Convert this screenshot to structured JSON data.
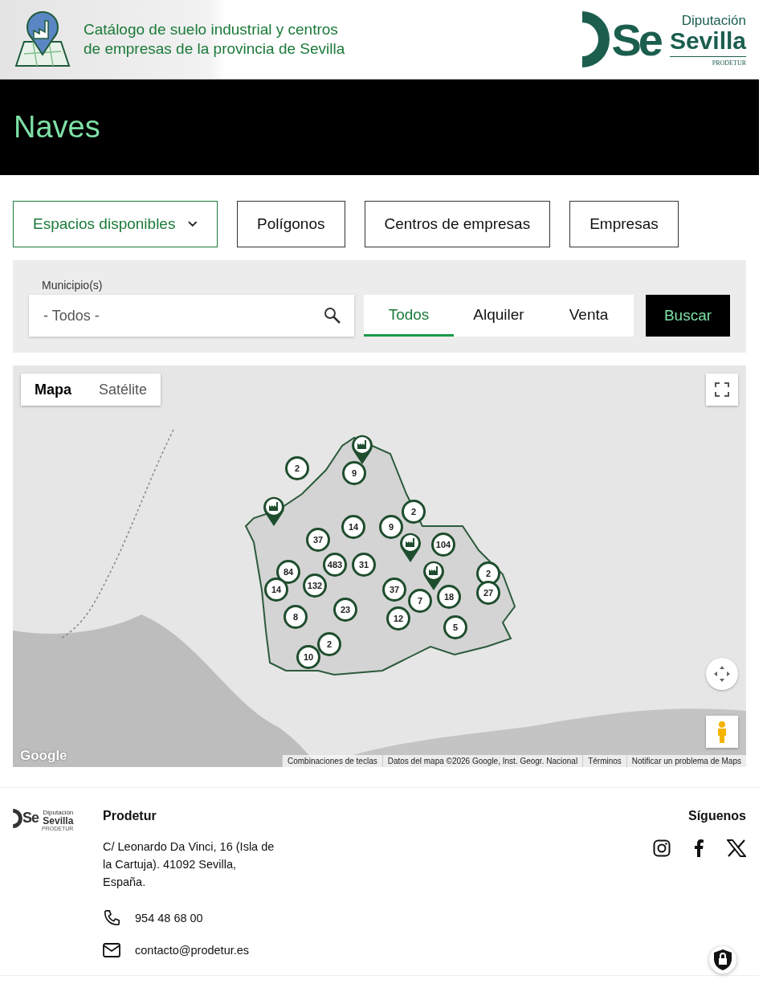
{
  "header": {
    "title": "Catálogo de suelo industrial y centros de empresas de la provincia de Sevilla",
    "logo": {
      "mark": "Se",
      "line_1": "Diputación",
      "line_2": "Sevilla",
      "line_3": "PRODETUR"
    }
  },
  "page_title": "Naves",
  "categories": [
    {
      "label": "Espacios disponibles",
      "selected": true,
      "dropdown": true
    },
    {
      "label": "Polígonos",
      "selected": false,
      "dropdown": false
    },
    {
      "label": "Centros de empresas",
      "selected": false,
      "dropdown": false
    },
    {
      "label": "Empresas",
      "selected": false,
      "dropdown": false
    }
  ],
  "search": {
    "label": "Municipio(s)",
    "value": "- Todos -",
    "modes": [
      {
        "label": "Todos",
        "selected": true
      },
      {
        "label": "Alquiler",
        "selected": false
      },
      {
        "label": "Venta",
        "selected": false
      }
    ],
    "button": "Buscar"
  },
  "map": {
    "types": [
      {
        "label": "Mapa",
        "selected": true
      },
      {
        "label": "Satélite",
        "selected": false
      }
    ],
    "markers": [
      {
        "kind": "cluster",
        "label": "2"
      },
      {
        "kind": "cluster",
        "label": "9"
      },
      {
        "kind": "cluster",
        "label": "14"
      },
      {
        "kind": "cluster",
        "label": "9"
      },
      {
        "kind": "cluster",
        "label": "2"
      },
      {
        "kind": "cluster",
        "label": "37"
      },
      {
        "kind": "cluster",
        "label": "104"
      },
      {
        "kind": "cluster",
        "label": "84"
      },
      {
        "kind": "cluster",
        "label": "483"
      },
      {
        "kind": "cluster",
        "label": "31"
      },
      {
        "kind": "cluster",
        "label": "14"
      },
      {
        "kind": "cluster",
        "label": "132"
      },
      {
        "kind": "cluster",
        "label": "37"
      },
      {
        "kind": "cluster",
        "label": "7"
      },
      {
        "kind": "cluster",
        "label": "18"
      },
      {
        "kind": "cluster",
        "label": "2"
      },
      {
        "kind": "cluster",
        "label": "27"
      },
      {
        "kind": "cluster",
        "label": "8"
      },
      {
        "kind": "cluster",
        "label": "23"
      },
      {
        "kind": "cluster",
        "label": "12"
      },
      {
        "kind": "cluster",
        "label": "5"
      },
      {
        "kind": "cluster",
        "label": "2"
      },
      {
        "kind": "cluster",
        "label": "10"
      },
      {
        "kind": "pin"
      },
      {
        "kind": "pin"
      },
      {
        "kind": "pin"
      },
      {
        "kind": "pin"
      }
    ],
    "google": "Google",
    "attribution": [
      "Combinaciones de teclas",
      "Datos del mapa ©2026 Google, Inst. Geogr. Nacional",
      "Términos",
      "Notificar un problema de Maps"
    ]
  },
  "footer": {
    "logo": {
      "mark": "Se",
      "line_1": "Diputación",
      "line_2": "Sevilla",
      "line_3": "PRODETUR"
    },
    "org": "Prodetur",
    "address": "C/ Leonardo Da Vinci, 16 (Isla de la Cartuja). 41092 Sevilla, España.",
    "phone": "954 48 68 00",
    "email": "contacto@prodetur.es",
    "follow": "Síguenos"
  }
}
